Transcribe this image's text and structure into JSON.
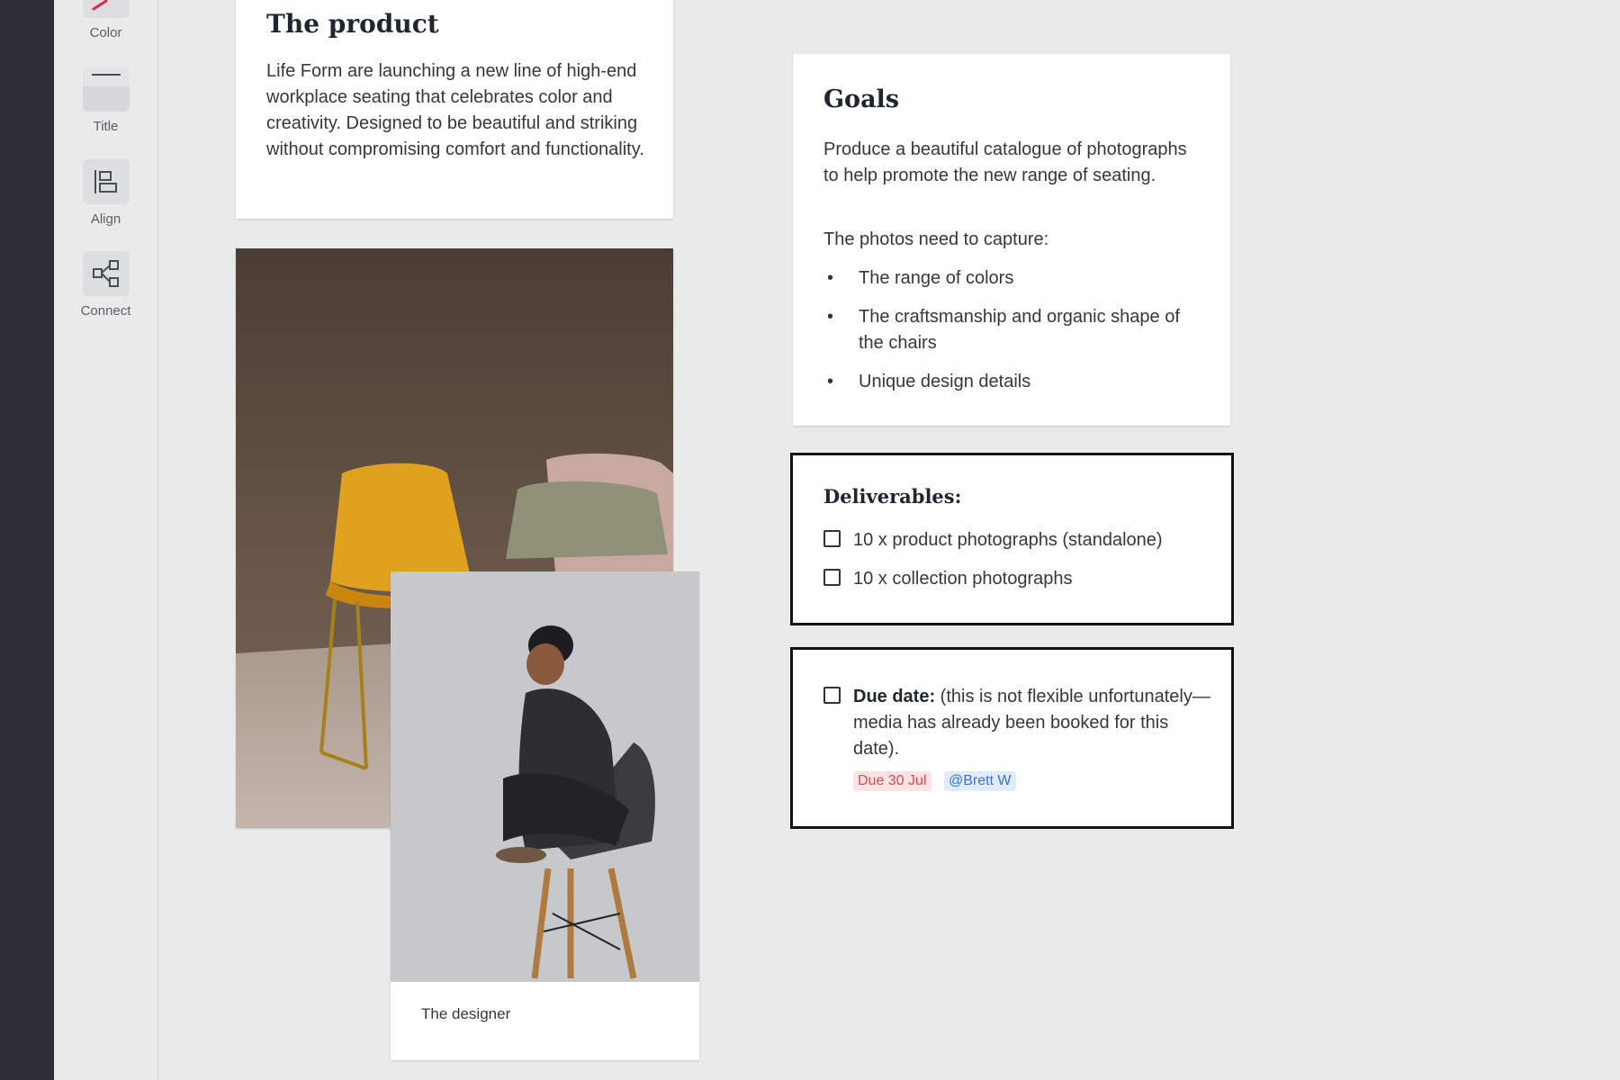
{
  "toolbar": {
    "tools": [
      {
        "label": "Color",
        "icon": "color-icon"
      },
      {
        "label": "Title",
        "icon": "title-icon"
      },
      {
        "label": "Align",
        "icon": "align-icon"
      },
      {
        "label": "Connect",
        "icon": "connect-icon"
      }
    ]
  },
  "product_card": {
    "title": "The product",
    "body": "Life Form are launching a new line of high-end workplace seating that celebrates color and creativity. Designed to be beautiful and striking without compromising comfort and functionality."
  },
  "goals_card": {
    "title": "Goals",
    "intro": "Produce a beautiful catalogue of photographs to help promote the new range of seating.",
    "capture_label": "The photos need to capture:",
    "bullets": [
      "The range of colors",
      "The craftsmanship and organic shape of the chairs",
      "Unique design details"
    ]
  },
  "deliverables_card": {
    "title": "Deliverables:",
    "items": [
      "10 x product photographs (standalone)",
      "10 x collection photographs"
    ]
  },
  "due_card": {
    "bold_label": "Due date:",
    "text": " (this is not flexible unfortunately—media has already been booked for this date).",
    "due_tag": "Due 30 Jul",
    "mention_tag": "@Brett W"
  },
  "designer_card": {
    "caption": "The designer"
  },
  "colors": {
    "due_tag_bg": "#fde3e3",
    "due_tag_text": "#e0474c",
    "mention_tag_bg": "#e1ecfb",
    "mention_tag_text": "#3a6fd8",
    "color_tool_accent": "#e0284f"
  }
}
